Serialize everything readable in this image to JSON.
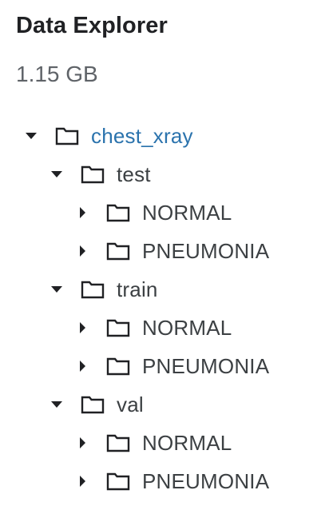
{
  "header": {
    "title": "Data Explorer",
    "size": "1.15 GB"
  },
  "tree": {
    "root": {
      "label": "chest_xray",
      "expanded": true,
      "children": [
        {
          "label": "test",
          "expanded": true,
          "children": [
            {
              "label": "NORMAL",
              "expanded": false
            },
            {
              "label": "PNEUMONIA",
              "expanded": false
            }
          ]
        },
        {
          "label": "train",
          "expanded": true,
          "children": [
            {
              "label": "NORMAL",
              "expanded": false
            },
            {
              "label": "PNEUMONIA",
              "expanded": false
            }
          ]
        },
        {
          "label": "val",
          "expanded": true,
          "children": [
            {
              "label": "NORMAL",
              "expanded": false
            },
            {
              "label": "PNEUMONIA",
              "expanded": false
            }
          ]
        }
      ]
    }
  },
  "colors": {
    "link": "#2b73ad",
    "text": "#3c4043",
    "icon": "#202124"
  },
  "icons": {
    "expanded": "caret-down-icon",
    "collapsed": "caret-right-icon",
    "folder": "folder-icon"
  }
}
